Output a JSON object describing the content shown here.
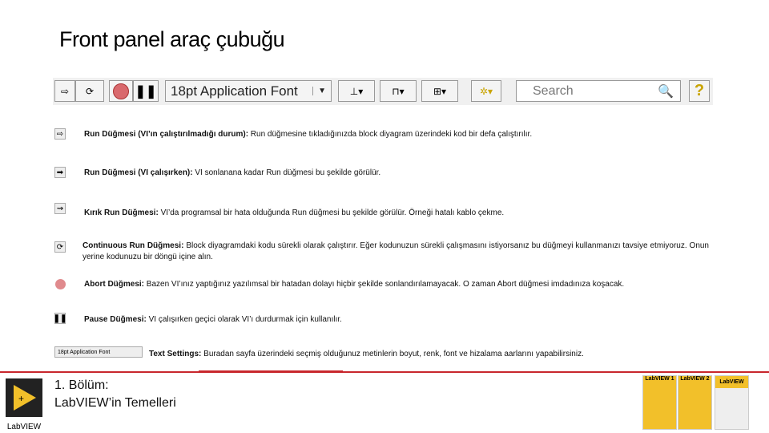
{
  "title": "Front panel araç çubuğu",
  "toolbar": {
    "font_label": "18pt Application Font",
    "search_placeholder": "Search",
    "help": "?"
  },
  "items": [
    {
      "icon": "run-arrow-icon",
      "bold": "Run Düğmesi (VI’ın çalıştırılmadığı durum):",
      "text": " Run düğmesine tıkladığınızda block diyagram üzerindeki kod bir defa çalıştırılır."
    },
    {
      "icon": "run-running-icon",
      "bold": "Run Düğmesi (VI çalışırken):",
      "text": " VI sonlanana kadar Run düğmesi bu şekilde görülür."
    },
    {
      "icon": "broken-run-icon",
      "bold": "Kırık Run Düğmesi:",
      "text": " VI’da programsal bir hata olduğunda Run düğmesi bu şekilde görülür. Örneği hatalı kablo çekme."
    },
    {
      "icon": "continuous-run-icon",
      "bold": "Continuous Run Düğmesi:",
      "text": " Block diyagramdaki kodu sürekli olarak çalıştırır. Eğer kodunuzun sürekli çalışmasını istiyorsanız bu düğmeyi kullanmanızı tavsiye etmiyoruz. Onun yerine kodunuzu bir döngü içine alın."
    },
    {
      "icon": "abort-icon",
      "bold": "Abort Düğmesi:",
      "text": " Bazen VI’ınız yaptığınız yazılımsal bir hatadan dolayı hiçbir şekilde sonlandırılamayacak. O zaman Abort düğmesi imdadınıza koşacak."
    },
    {
      "icon": "pause-icon",
      "bold": "Pause Düğmesi:",
      "text": " VI çalışırken geçici olarak VI’ı durdurmak için kullanılır."
    },
    {
      "icon": "text-settings-icon",
      "bold": "Text Settings:",
      "text": " Buradan sayfa üzerindeki seçmiş olduğunuz metinlerin boyut, renk, font ve hizalama aarlarını yapabilirsiniz.",
      "mini_label": "18pt Application Font"
    }
  ],
  "footer": {
    "chapter_line1": "1.   Bölüm:",
    "chapter_line2": "LabVIEW’in Temelleri",
    "logo_text": "LabVIEW",
    "books": [
      "LabVIEW 1",
      "LabVIEW 2",
      "LabVIEW"
    ]
  },
  "colors": {
    "accent": "#c8272d",
    "book": "#f2c02a"
  }
}
